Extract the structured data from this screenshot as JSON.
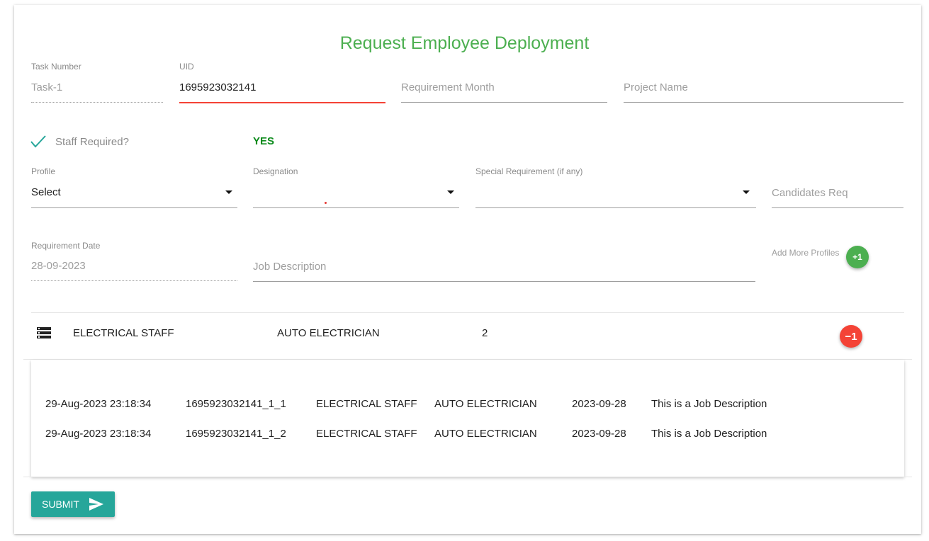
{
  "form": {
    "title": "Request Employee Deployment",
    "task_number": {
      "label": "Task Number",
      "value": "Task-1"
    },
    "uid": {
      "label": "UID",
      "value": "1695923032141"
    },
    "requirement_month": {
      "placeholder": "Requirement Month"
    },
    "project_name": {
      "placeholder": "Project Name"
    },
    "staff_required": {
      "label": "Staff Required?",
      "checked": true,
      "status": "YES"
    },
    "profile": {
      "label": "Profile",
      "value": "Select"
    },
    "designation": {
      "label": "Designation",
      "value": ""
    },
    "special_requirement": {
      "label": "Special Requirement (if any)",
      "value": ""
    },
    "candidates_req": {
      "placeholder": "Candidates Req"
    },
    "requirement_date": {
      "label": "Requirement Date",
      "value": "28-09-2023"
    },
    "job_description": {
      "placeholder": "Job Description"
    },
    "add_more": {
      "label": "Add More Profiles",
      "button": "+1"
    }
  },
  "profile_row": {
    "icon": "list-icon",
    "profile": "ELECTRICAL STAFF",
    "designation": "AUTO ELECTRICIAN",
    "count": "2",
    "remove_button": "−1"
  },
  "details": [
    {
      "timestamp": "29-Aug-2023 23:18:34",
      "id": "1695923032141_1_1",
      "profile": "ELECTRICAL STAFF",
      "designation": "AUTO ELECTRICIAN",
      "date": "2023-09-28",
      "description": "This is a Job Description"
    },
    {
      "timestamp": "29-Aug-2023 23:18:34",
      "id": "1695923032141_1_2",
      "profile": "ELECTRICAL STAFF",
      "designation": "AUTO ELECTRICIAN",
      "date": "2023-09-28",
      "description": "This is a Job Description"
    }
  ],
  "submit": {
    "label": "SUBMIT",
    "icon": "send-icon"
  },
  "colors": {
    "title": "#4caf50",
    "accent": "#26a69a",
    "danger": "#f44336",
    "yes": "#0a8a1a"
  }
}
